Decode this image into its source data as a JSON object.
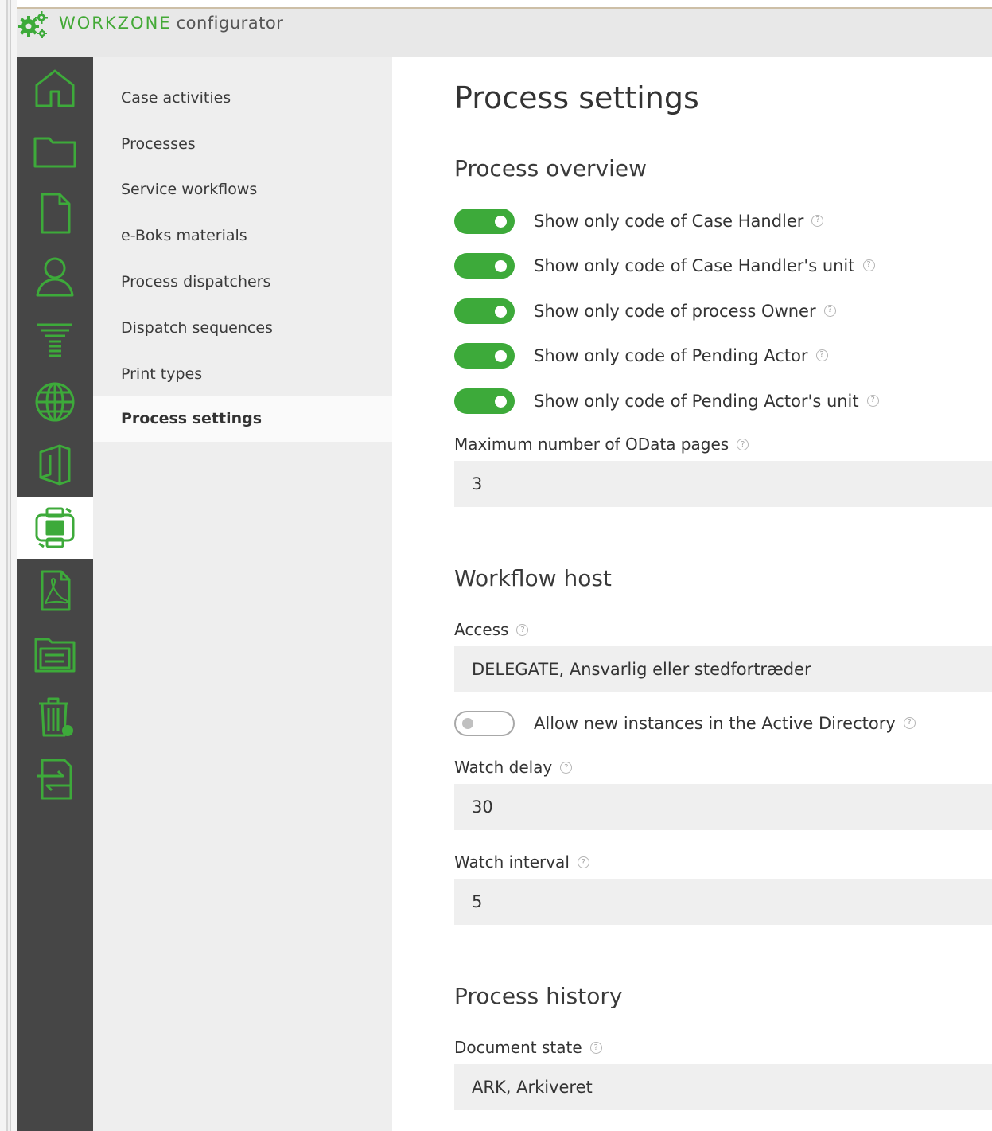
{
  "app": {
    "brand_primary": "WORKZONE",
    "brand_secondary": "configurator"
  },
  "colors": {
    "accent": "#3daa3a",
    "rail_bg": "#464646",
    "subnav_bg": "#eeeeee",
    "field_bg": "#efefef"
  },
  "rail": {
    "items": [
      {
        "icon": "home-icon"
      },
      {
        "icon": "folder-icon"
      },
      {
        "icon": "document-icon"
      },
      {
        "icon": "user-icon"
      },
      {
        "icon": "stack-filter-icon"
      },
      {
        "icon": "globe-icon"
      },
      {
        "icon": "office-icon"
      },
      {
        "icon": "process-icon",
        "active": true
      },
      {
        "icon": "pdf-icon"
      },
      {
        "icon": "drawers-icon"
      },
      {
        "icon": "trash-icon"
      },
      {
        "icon": "transfer-icon"
      }
    ]
  },
  "subnav": {
    "items": [
      {
        "label": "Case activities"
      },
      {
        "label": "Processes"
      },
      {
        "label": "Service workflows"
      },
      {
        "label": "e-Boks materials"
      },
      {
        "label": "Process dispatchers"
      },
      {
        "label": "Dispatch sequences"
      },
      {
        "label": "Print types"
      },
      {
        "label": "Process settings",
        "active": true
      }
    ]
  },
  "main": {
    "title": "Process settings",
    "overview": {
      "heading": "Process overview",
      "toggles": [
        {
          "label": "Show only code of Case Handler",
          "on": true
        },
        {
          "label": "Show only code of Case Handler's unit",
          "on": true
        },
        {
          "label": "Show only code of process Owner",
          "on": true
        },
        {
          "label": "Show only code of Pending Actor",
          "on": true
        },
        {
          "label": "Show only code of Pending Actor's unit",
          "on": true
        }
      ],
      "odata_label": "Maximum number of OData pages",
      "odata_value": "3"
    },
    "workflow": {
      "heading": "Workflow host",
      "access_label": "Access",
      "access_value": "DELEGATE, Ansvarlig eller stedfortræder",
      "allow_label": "Allow new instances in the Active Directory",
      "allow_on": false,
      "watch_delay_label": "Watch delay",
      "watch_delay_value": "30",
      "watch_interval_label": "Watch interval",
      "watch_interval_value": "5"
    },
    "history": {
      "heading": "Process history",
      "doc_state_label": "Document state",
      "doc_state_value": "ARK, Arkiveret"
    },
    "help_glyph": "?"
  }
}
